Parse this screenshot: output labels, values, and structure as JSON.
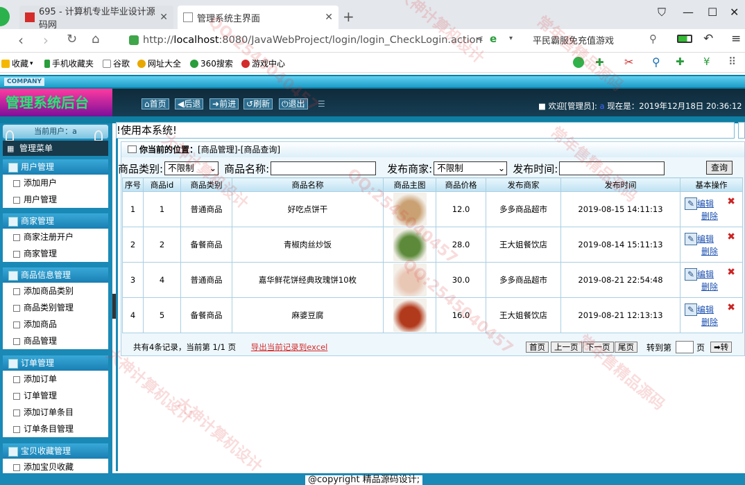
{
  "browser": {
    "tabs": [
      {
        "title": "695 - 计算机专业毕业设计源码网"
      },
      {
        "title": "管理系统主界面"
      }
    ],
    "url": {
      "scheme": "http://",
      "host": "localhost",
      "path": ":8080/JavaWebProject/login/login_CheckLogin.action"
    },
    "search_hint": "平民霸服免充值游戏",
    "bookmarks": [
      "收藏",
      "手机收藏夹",
      "谷歌",
      "网址大全",
      "360搜索",
      "游戏中心"
    ]
  },
  "app": {
    "company": "COMPANY",
    "title": "管理系统后台",
    "nav": [
      "首页",
      "后退",
      "前进",
      "刷新",
      "退出"
    ],
    "welcome": "欢迎[管理员]: ",
    "now": "现在是：2019年12月18日 20:36:12",
    "current_user": "当前用户：a",
    "menu_title": "管理菜单",
    "marquee": "!使用本系统!"
  },
  "sidebar": {
    "groups": [
      {
        "title": "用户管理",
        "items": [
          "添加用户",
          "用户管理"
        ]
      },
      {
        "title": "商家管理",
        "items": [
          "商家注册开户",
          "商家管理"
        ]
      },
      {
        "title": "商品信息管理",
        "items": [
          "添加商品类别",
          "商品类别管理",
          "添加商品",
          "商品管理"
        ]
      },
      {
        "title": "订单管理",
        "items": [
          "添加订单",
          "订单管理",
          "添加订单条目",
          "订单条目管理"
        ]
      },
      {
        "title": "宝贝收藏管理",
        "items": [
          "添加宝贝收藏"
        ]
      }
    ]
  },
  "main": {
    "position_label": "你当前的位置：",
    "position": "[商品管理]-[商品查询]",
    "filters": {
      "category_label": "商品类别:",
      "category_value": "不限制",
      "name_label": "商品名称:",
      "merchant_label": "发布商家:",
      "merchant_value": "不限制",
      "time_label": "发布时间:",
      "query_btn": "查询"
    },
    "table": {
      "headers": [
        "序号",
        "商品id",
        "商品类别",
        "商品名称",
        "商品主图",
        "商品价格",
        "发布商家",
        "发布时间",
        "基本操作"
      ],
      "rows": [
        {
          "no": "1",
          "id": "1",
          "cat": "普通商品",
          "name": "好吃点饼干",
          "price": "12.0",
          "merchant": "多多商品超市",
          "time": "2019-08-15 14:11:13",
          "img": "#c9a173"
        },
        {
          "no": "2",
          "id": "2",
          "cat": "备餐商品",
          "name": "青椒肉丝炒饭",
          "price": "28.0",
          "merchant": "王大姐餐饮店",
          "time": "2019-08-14 15:11:13",
          "img": "#5d8a3a"
        },
        {
          "no": "3",
          "id": "4",
          "cat": "普通商品",
          "name": "嘉华鲜花饼经典玫瑰饼10枚",
          "price": "30.0",
          "merchant": "多多商品超市",
          "time": "2019-08-21 22:54:48",
          "img": "#e9c7b5"
        },
        {
          "no": "4",
          "id": "5",
          "cat": "备餐商品",
          "name": "麻婆豆腐",
          "price": "16.0",
          "merchant": "王大姐餐饮店",
          "time": "2019-08-21 12:13:13",
          "img": "#b23a1c"
        }
      ],
      "edit_label": "编辑",
      "delete_label": "删除"
    },
    "pager": {
      "summary": "共有4条记录，当前第 1/1 页",
      "export": "导出当前记录到excel",
      "first": "首页",
      "prev": "上一页",
      "next": "下一页",
      "last": "尾页",
      "goto_label": "转到第",
      "page_unit": "页",
      "go": "➡转"
    }
  },
  "footer": {
    "copyright": "@copyright 精品源码设计;"
  },
  "watermarks": [
    "大神计算机设计",
    "QQ:2545040457",
    "常年售精品源码"
  ]
}
